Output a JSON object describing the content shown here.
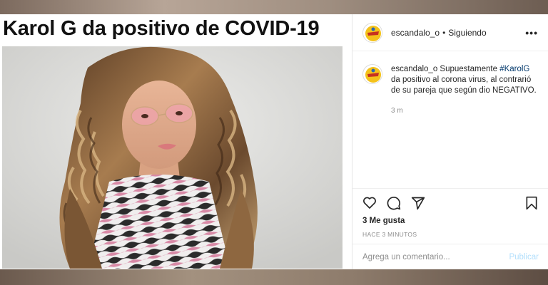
{
  "headline": "Karol G da positivo de COVID-19",
  "photo": {
    "icon": "portrait-photo"
  },
  "header": {
    "avatar_icon": "escandalo-logo-icon",
    "username": "escandalo_o",
    "separator": "•",
    "follow_status": "Siguiendo",
    "more_label": "•••"
  },
  "caption": {
    "avatar_icon": "escandalo-logo-icon",
    "username": "escandalo_o",
    "text_before": " Supuestamente ",
    "hashtag": "#KarolG",
    "text_after": " da positivo al corona virus, al contrarió de su pareja que según dio NEGATIVO.",
    "time_ago": "3 m"
  },
  "actions": {
    "like_icon": "heart-icon",
    "comment_icon": "comment-icon",
    "share_icon": "share-icon",
    "save_icon": "bookmark-icon"
  },
  "likes": "3 Me gusta",
  "posted": "HACE 3 MINUTOS",
  "comment_box": {
    "placeholder": "Agrega un comentario...",
    "publish_label": "Publicar"
  },
  "colors": {
    "hashtag": "#00376b",
    "publish_disabled": "#b2dffc",
    "muted": "#8e8e8e"
  }
}
